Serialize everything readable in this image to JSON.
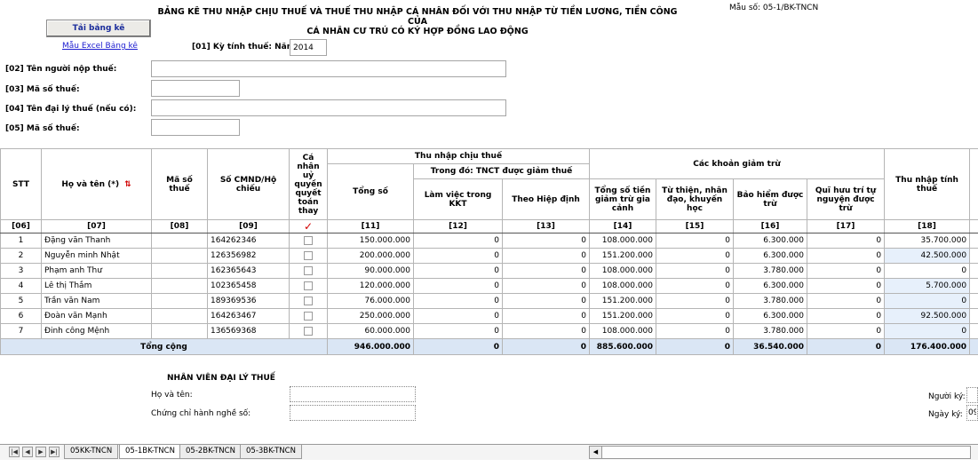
{
  "header": {
    "load_button": "Tải bảng kê",
    "excel_link": "Mẫu Excel Bảng kê",
    "title_line1": "BẢNG KÊ THU NHẬP CHỊU THUẾ VÀ THUẾ THU NHẬP CÁ NHÂN ĐỐI VỚI THU NHẬP TỪ TIỀN LƯƠNG, TIỀN CÔNG CỦA",
    "title_line2": "CÁ NHÂN CƯ TRÚ CÓ KÝ HỢP ĐỒNG LAO ĐỘNG",
    "form_code": "Mẫu số:   05-1/BK-TNCN"
  },
  "period": {
    "label": "[01] Kỳ tính thuế: Năm",
    "year": "2014"
  },
  "fields": {
    "taxpayer_name_label": "[02] Tên người nộp thuế:",
    "tax_code_label": "[03] Mã số thuế:",
    "agent_name_label": "[04] Tên đại lý thuế (nếu có):",
    "agent_tax_code_label": "[05] Mã số thuế:"
  },
  "table": {
    "headers": {
      "stt": "STT",
      "name": "Họ và tên (*)",
      "tax_code": "Mã số thuế",
      "id_no": "Số CMND/Hộ chiếu",
      "authorized": "Cá nhân uỷ quyền quyết toán thay",
      "taxable_income_group": "Thu nhập chịu thuế",
      "total": "Tổng số",
      "reduced_group": "Trong đó: TNCT được giảm thuế",
      "kkt": "Làm việc trong KKT",
      "agreement": "Theo Hiệp định",
      "deductions_group": "Các khoản giảm trừ",
      "family_deduction": "Tổng số tiền giảm trừ gia cảnh",
      "charity": "Từ thiện, nhân đạo, khuyến học",
      "insurance": "Bảo hiểm được trừ",
      "pension": "Quĩ hưu trí tự nguyện được trừ",
      "assessable_income": "Thu nhập tính thuế"
    },
    "codes": [
      "[06]",
      "[07]",
      "[08]",
      "[09]",
      "✓",
      "[11]",
      "[12]",
      "[13]",
      "[14]",
      "[15]",
      "[16]",
      "[17]",
      "[18]"
    ],
    "rows": [
      {
        "stt": "1",
        "name": "Đặng văn Thanh",
        "tax_code": "",
        "id_no": "164262346",
        "total": "150.000.000",
        "kkt": "0",
        "agreement": "0",
        "family": "108.000.000",
        "charity": "0",
        "insurance": "6.300.000",
        "pension": "0",
        "assessable": "35.700.000"
      },
      {
        "stt": "2",
        "name": "Nguyễn minh Nhật",
        "tax_code": "",
        "id_no": "126356982",
        "total": "200.000.000",
        "kkt": "0",
        "agreement": "0",
        "family": "151.200.000",
        "charity": "0",
        "insurance": "6.300.000",
        "pension": "0",
        "assessable": "42.500.000"
      },
      {
        "stt": "3",
        "name": "Phạm anh Thư",
        "tax_code": "",
        "id_no": "162365643",
        "total": "90.000.000",
        "kkt": "0",
        "agreement": "0",
        "family": "108.000.000",
        "charity": "0",
        "insurance": "3.780.000",
        "pension": "0",
        "assessable": "0"
      },
      {
        "stt": "4",
        "name": "Lê thị Thắm",
        "tax_code": "",
        "id_no": "102365458",
        "total": "120.000.000",
        "kkt": "0",
        "agreement": "0",
        "family": "108.000.000",
        "charity": "0",
        "insurance": "6.300.000",
        "pension": "0",
        "assessable": "5.700.000"
      },
      {
        "stt": "5",
        "name": "Trần văn Nam",
        "tax_code": "",
        "id_no": "189369536",
        "total": "76.000.000",
        "kkt": "0",
        "agreement": "0",
        "family": "151.200.000",
        "charity": "0",
        "insurance": "3.780.000",
        "pension": "0",
        "assessable": "0"
      },
      {
        "stt": "6",
        "name": "Đoàn văn Mạnh",
        "tax_code": "",
        "id_no": "164263467",
        "total": "250.000.000",
        "kkt": "0",
        "agreement": "0",
        "family": "151.200.000",
        "charity": "0",
        "insurance": "6.300.000",
        "pension": "0",
        "assessable": "92.500.000"
      },
      {
        "stt": "7",
        "name": "Đinh công Mệnh",
        "tax_code": "",
        "id_no": "136569368",
        "total": "60.000.000",
        "kkt": "0",
        "agreement": "0",
        "family": "108.000.000",
        "charity": "0",
        "insurance": "3.780.000",
        "pension": "0",
        "assessable": "0"
      }
    ],
    "totals": {
      "label": "Tổng cộng",
      "total": "946.000.000",
      "kkt": "0",
      "agreement": "0",
      "family": "885.600.000",
      "charity": "0",
      "insurance": "36.540.000",
      "pension": "0",
      "assessable": "176.400.000"
    }
  },
  "agent": {
    "title": "NHÂN VIÊN ĐẠI LÝ THUẾ",
    "name_label": "Họ và tên:",
    "cert_label": "Chứng chỉ hành nghề số:",
    "signer_label": "Người ký:",
    "sign_date_label": "Ngày ký:",
    "sign_date_value": "09"
  },
  "sheet_tabs": [
    "05KK-TNCN",
    "05-1BK-TNCN",
    "05-2BK-TNCN",
    "05-3BK-TNCN"
  ],
  "active_tab": "05-1BK-TNCN",
  "icons": {
    "sort": "sort-arrows-icon",
    "check": "check-mark-icon"
  },
  "colors": {
    "total_row": "#dae6f5",
    "highlight_cell": "#e7f0fb",
    "link": "#1b1bd0",
    "accent_red": "#d10000"
  }
}
